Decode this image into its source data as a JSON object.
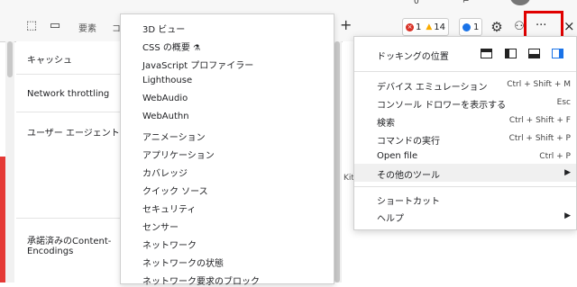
{
  "toolbar": {
    "elements_tab": "要素",
    "console_tab_partial": "コ",
    "top_counter": "0",
    "error_count": "1",
    "warning_count": "14",
    "info_count": "1",
    "more_label": "···",
    "close_label": "×",
    "plus_label": "+"
  },
  "settings_list": {
    "cache": "キャッシュ",
    "network_throttling": "Network throttling",
    "user_agent": "ユーザー エージェント",
    "accepted_content_1": "承諾済みのContent-",
    "accepted_content_2": "Encodings"
  },
  "tool_menu": {
    "items": [
      "3D ビュー",
      "CSS の概要",
      "JavaScript プロファイラー",
      "Lighthouse",
      "WebAudio",
      "WebAuthn",
      "アニメーション",
      "アプリケーション",
      "カバレッジ",
      "クイック ソース",
      "セキュリティ",
      "センサー",
      "ネットワーク",
      "ネットワークの状態",
      "ネットワーク要求のブロック"
    ]
  },
  "background_fragment": "Kit/",
  "custom_menu": {
    "docking_label": "ドッキングの位置",
    "device_emulation": "デバイス エミュレーション",
    "device_emulation_shortcut": "Ctrl + Shift + M",
    "console_drawer": "コンソール ドロワーを表示する",
    "console_drawer_shortcut": "Esc",
    "search": "検索",
    "search_shortcut": "Ctrl + Shift + F",
    "run_command": "コマンドの実行",
    "run_command_shortcut": "Ctrl + Shift + P",
    "open_file": "Open file",
    "open_file_shortcut": "Ctrl + P",
    "more_tools": "その他のツール",
    "shortcuts": "ショートカット",
    "help": "ヘルプ"
  },
  "colors": {
    "highlight": "#e00000",
    "error": "#d93025",
    "warning": "#f9ab00",
    "info": "#1a73e8"
  }
}
